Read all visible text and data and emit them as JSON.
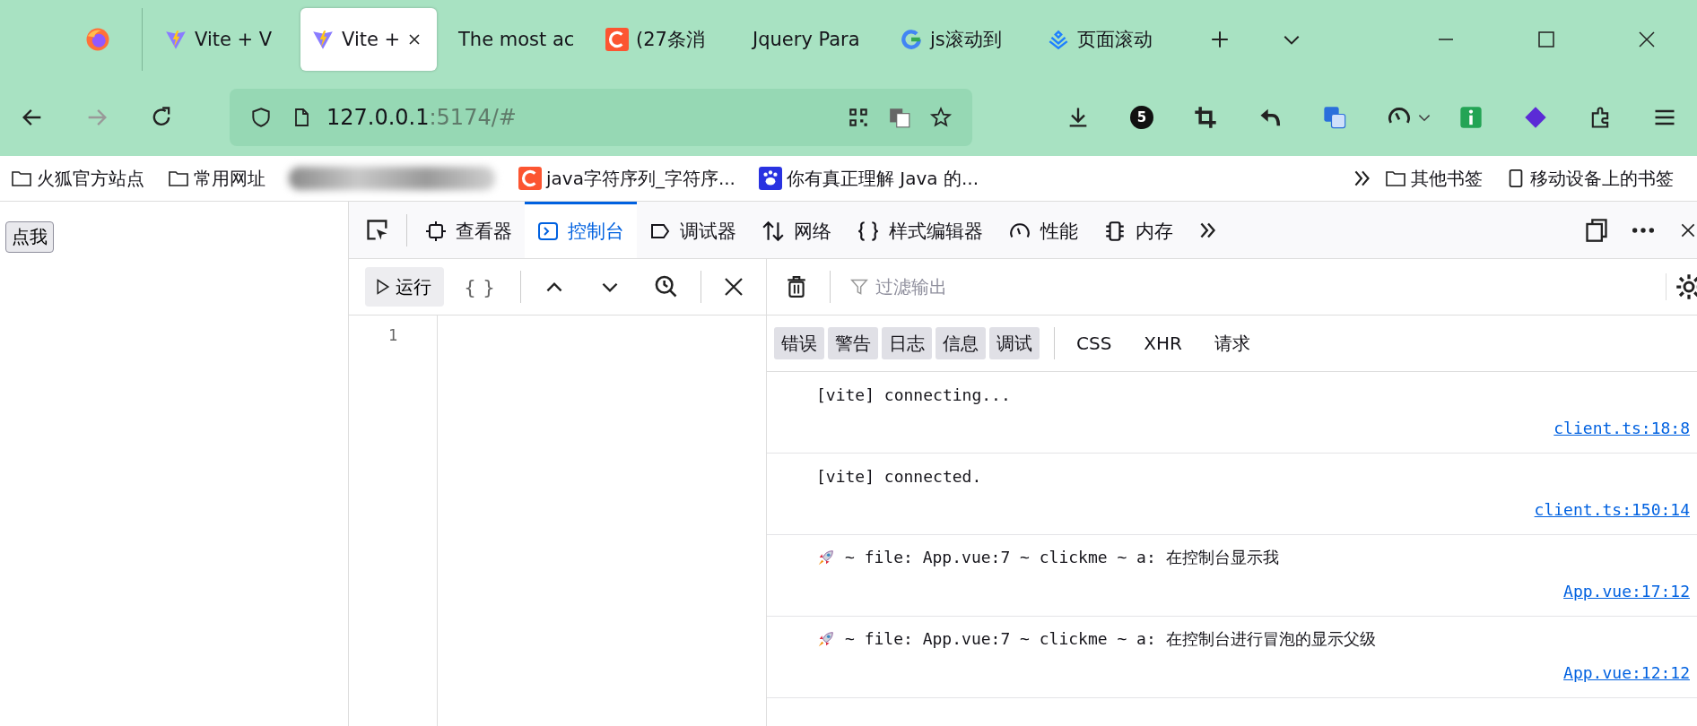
{
  "browser_tabs": [
    {
      "title": "Vite + V",
      "kind": "vite",
      "selected": false
    },
    {
      "title": "Vite +",
      "kind": "vite",
      "selected": true
    },
    {
      "title": "The most ac",
      "kind": "none",
      "selected": false
    },
    {
      "title": "(27条消",
      "kind": "csdn",
      "selected": false
    },
    {
      "title": "Jquery Para",
      "kind": "none",
      "selected": false
    },
    {
      "title": "js滚动到",
      "kind": "google",
      "selected": false
    },
    {
      "title": "页面滚动",
      "kind": "juejin",
      "selected": false
    }
  ],
  "address": {
    "host": "127.0.0.1",
    "rest": ":5174/#"
  },
  "extension_badge": "5",
  "bookmarks": [
    {
      "label": "火狐官方站点",
      "kind": "folder"
    },
    {
      "label": "常用网址",
      "kind": "folder"
    },
    {
      "kind": "blurred"
    },
    {
      "label": "java字符序列_字符序...",
      "kind": "csdn"
    },
    {
      "label": "你有真正理解 Java 的...",
      "kind": "baidu"
    }
  ],
  "other_bookmarks": [
    {
      "label": "其他书签",
      "kind": "folder"
    },
    {
      "label": "移动设备上的书签",
      "kind": "mobile"
    }
  ],
  "page": {
    "button": "点我"
  },
  "devtools": {
    "tabs": [
      {
        "label": "查看器",
        "kind": "inspector",
        "selected": false
      },
      {
        "label": "控制台",
        "kind": "console",
        "selected": true
      },
      {
        "label": "调试器",
        "kind": "debugger",
        "selected": false
      },
      {
        "label": "网络",
        "kind": "network",
        "selected": false
      },
      {
        "label": "样式编辑器",
        "kind": "style",
        "selected": false
      },
      {
        "label": "性能",
        "kind": "performance",
        "selected": false
      },
      {
        "label": "内存",
        "kind": "memory",
        "selected": false
      }
    ],
    "run_button": "运行",
    "pretty_print": "{ }",
    "line_numbers": [
      "1"
    ],
    "filter": {
      "placeholder": "过滤输出"
    },
    "levels": [
      {
        "label": "错误",
        "selected": true
      },
      {
        "label": "警告",
        "selected": true
      },
      {
        "label": "日志",
        "selected": true
      },
      {
        "label": "信息",
        "selected": true
      },
      {
        "label": "调试",
        "selected": true
      }
    ],
    "categories": [
      {
        "label": "CSS",
        "selected": false
      },
      {
        "label": "XHR",
        "selected": false
      },
      {
        "label": "请求",
        "selected": false
      }
    ],
    "messages": [
      {
        "kind": "plain",
        "text": "[vite] connecting...",
        "source": "client.ts:18:8"
      },
      {
        "kind": "plain",
        "text": "[vite] connected.",
        "source": "client.ts:150:14"
      },
      {
        "kind": "rocket",
        "text": "~ file: App.vue:7 ~ clickme ~ a: 在控制台显示我",
        "source": "App.vue:17:12"
      },
      {
        "kind": "rocket",
        "text": "~ file: App.vue:7 ~ clickme ~ a: 在控制台进行冒泡的显示父级",
        "source": "App.vue:12:12"
      }
    ]
  }
}
